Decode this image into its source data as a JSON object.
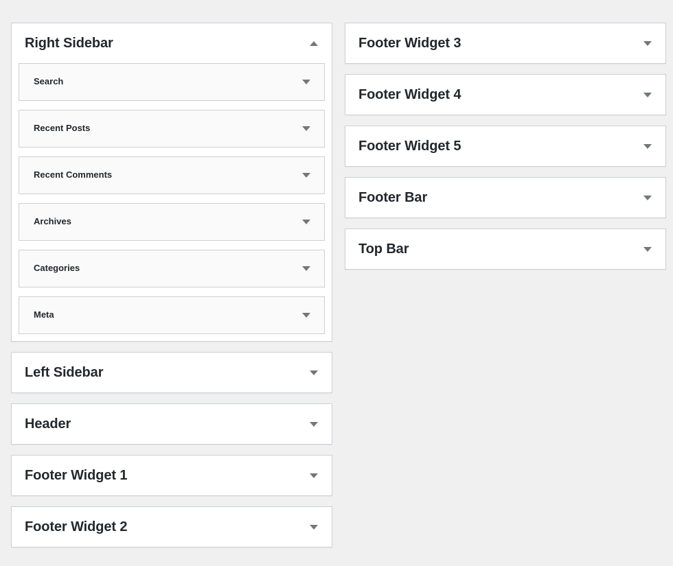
{
  "page": {
    "background_color": "#f0f0f1",
    "panel_background": "#ffffff",
    "widget_background": "#fafafa",
    "border_color": "#ccd0d4",
    "text_color": "#23282d",
    "arrow_color": "#72777c"
  },
  "columns": {
    "left": [
      {
        "title": "Right Sidebar",
        "state": "open",
        "toggle_icon": "chevron-up-icon",
        "widgets": [
          {
            "title": "Search",
            "toggle_icon": "chevron-down-icon"
          },
          {
            "title": "Recent Posts",
            "toggle_icon": "chevron-down-icon"
          },
          {
            "title": "Recent Comments",
            "toggle_icon": "chevron-down-icon"
          },
          {
            "title": "Archives",
            "toggle_icon": "chevron-down-icon"
          },
          {
            "title": "Categories",
            "toggle_icon": "chevron-down-icon"
          },
          {
            "title": "Meta",
            "toggle_icon": "chevron-down-icon"
          }
        ]
      },
      {
        "title": "Left Sidebar",
        "state": "collapsed",
        "toggle_icon": "chevron-down-icon",
        "widgets": []
      },
      {
        "title": "Header",
        "state": "collapsed",
        "toggle_icon": "chevron-down-icon",
        "widgets": []
      },
      {
        "title": "Footer Widget 1",
        "state": "collapsed",
        "toggle_icon": "chevron-down-icon",
        "widgets": []
      },
      {
        "title": "Footer Widget 2",
        "state": "collapsed",
        "toggle_icon": "chevron-down-icon",
        "widgets": []
      }
    ],
    "right": [
      {
        "title": "Footer Widget 3",
        "state": "collapsed",
        "toggle_icon": "chevron-down-icon",
        "widgets": []
      },
      {
        "title": "Footer Widget 4",
        "state": "collapsed",
        "toggle_icon": "chevron-down-icon",
        "widgets": []
      },
      {
        "title": "Footer Widget 5",
        "state": "collapsed",
        "toggle_icon": "chevron-down-icon",
        "widgets": []
      },
      {
        "title": "Footer Bar",
        "state": "collapsed",
        "toggle_icon": "chevron-down-icon",
        "widgets": []
      },
      {
        "title": "Top Bar",
        "state": "collapsed",
        "toggle_icon": "chevron-down-icon",
        "widgets": []
      }
    ]
  }
}
